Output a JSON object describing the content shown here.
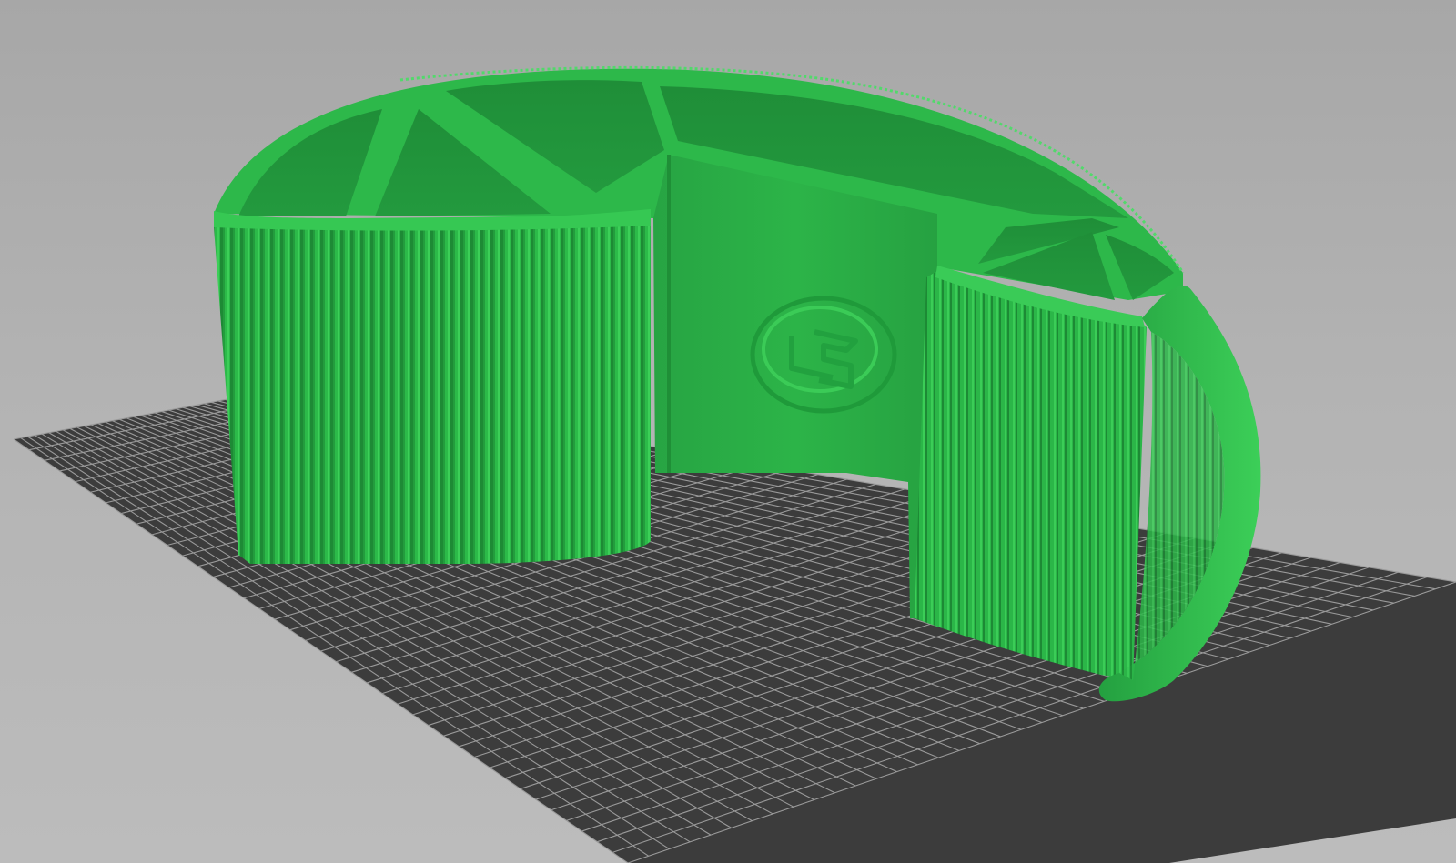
{
  "viewport": {
    "background_color": "#b0b0b0"
  },
  "build_plate": {
    "plate_color": "#3c3c3c",
    "grid_line_color": "#9a9a9a",
    "grid_divisions": 40
  },
  "model": {
    "color": "#2db84a",
    "shadow_color": "#1f8f37",
    "highlight_color": "#3fd05a",
    "emblem_icon": "logo-emblem-icon"
  }
}
